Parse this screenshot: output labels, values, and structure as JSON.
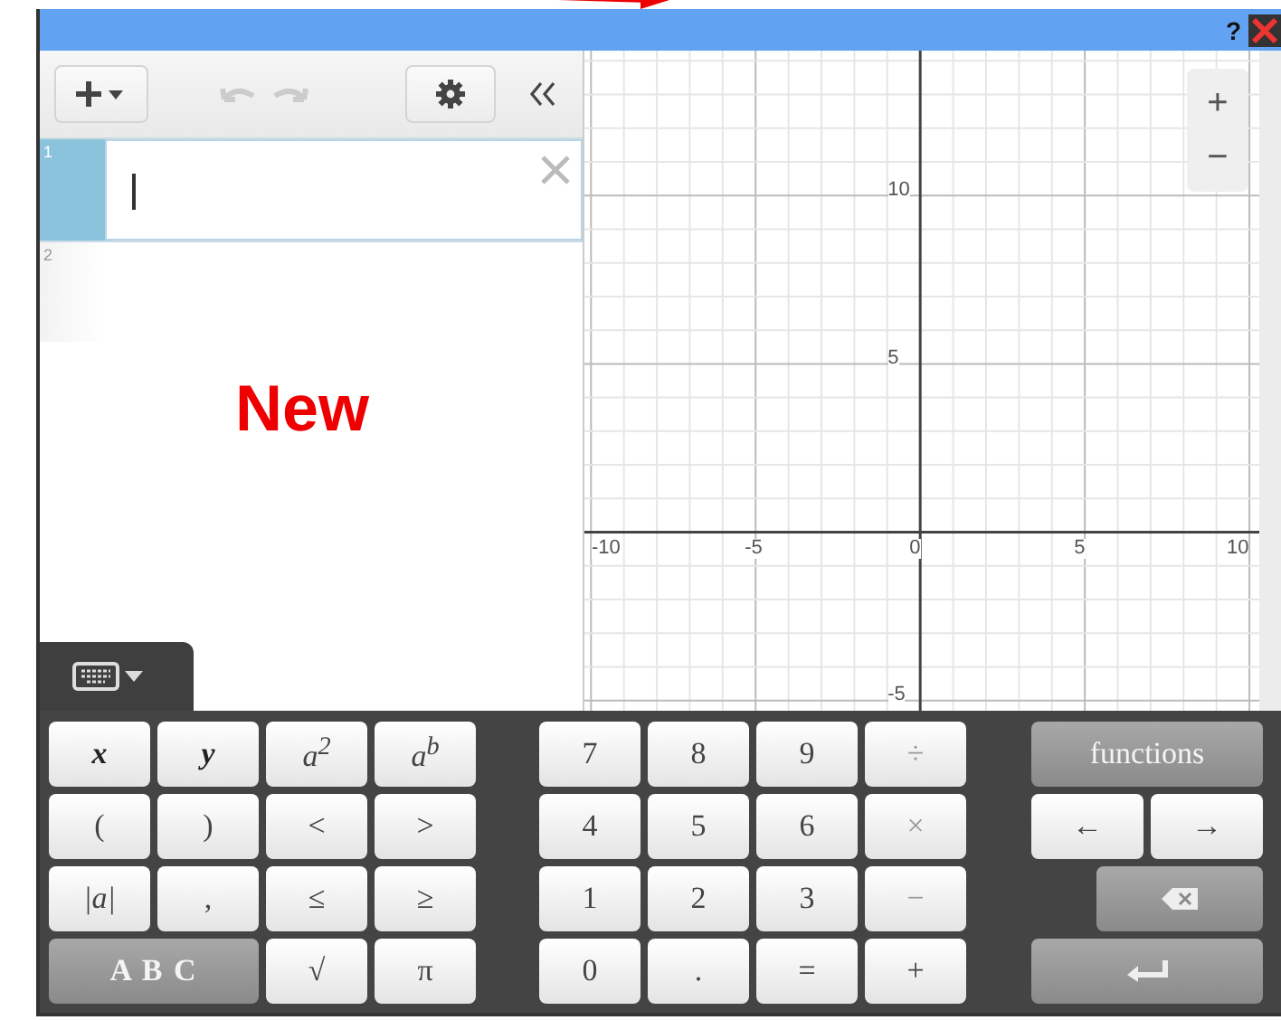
{
  "annotation": {
    "text": "New"
  },
  "title_bar": {
    "help": "?"
  },
  "expressions": [
    {
      "number": "1",
      "selected": true
    },
    {
      "number": "2",
      "selected": false
    }
  ],
  "keyboard_toggle": {
    "expanded": true
  },
  "graph": {
    "chart_data": {
      "type": "line",
      "grid": true,
      "xlim": [
        -10.2,
        10.3
      ],
      "ylim": [
        -5.3,
        14.3
      ],
      "xticks": [
        -10,
        -5,
        0,
        5,
        10
      ],
      "yticks": [
        -5,
        5,
        10
      ]
    }
  },
  "zoom": {
    "in": "+",
    "out": "−"
  },
  "keypad": {
    "left": [
      {
        "label": "x",
        "kind": "var"
      },
      {
        "label": "y",
        "kind": "var"
      },
      {
        "label": "a$^{2}$",
        "kind": "math"
      },
      {
        "label": "a$^{b}$",
        "kind": "math"
      },
      {
        "label": "(",
        "kind": "key"
      },
      {
        "label": ")",
        "kind": "key"
      },
      {
        "label": "<",
        "kind": "key"
      },
      {
        "label": ">",
        "kind": "key"
      },
      {
        "label": "|a|",
        "kind": "math"
      },
      {
        "label": ",",
        "kind": "key"
      },
      {
        "label": "≤",
        "kind": "key"
      },
      {
        "label": "≥",
        "kind": "key"
      },
      {
        "label": "A B C",
        "kind": "abc"
      },
      {
        "label": "√",
        "kind": "key"
      },
      {
        "label": "π",
        "kind": "key"
      }
    ],
    "numbers": [
      {
        "label": "7",
        "kind": "key"
      },
      {
        "label": "8",
        "kind": "key"
      },
      {
        "label": "9",
        "kind": "key"
      },
      {
        "label": "÷",
        "kind": "op"
      },
      {
        "label": "4",
        "kind": "key"
      },
      {
        "label": "5",
        "kind": "key"
      },
      {
        "label": "6",
        "kind": "key"
      },
      {
        "label": "×",
        "kind": "op"
      },
      {
        "label": "1",
        "kind": "key"
      },
      {
        "label": "2",
        "kind": "key"
      },
      {
        "label": "3",
        "kind": "key"
      },
      {
        "label": "−",
        "kind": "op"
      },
      {
        "label": "0",
        "kind": "key"
      },
      {
        "label": ".",
        "kind": "key"
      },
      {
        "label": "=",
        "kind": "key"
      },
      {
        "label": "+",
        "kind": "key"
      }
    ],
    "actions": [
      {
        "label": "functions",
        "kind": "wide"
      },
      {
        "label": "←",
        "kind": "arrow"
      },
      {
        "label": "→",
        "kind": "arrow"
      },
      {
        "kind": "backspace"
      },
      {
        "kind": "enter"
      }
    ]
  }
}
